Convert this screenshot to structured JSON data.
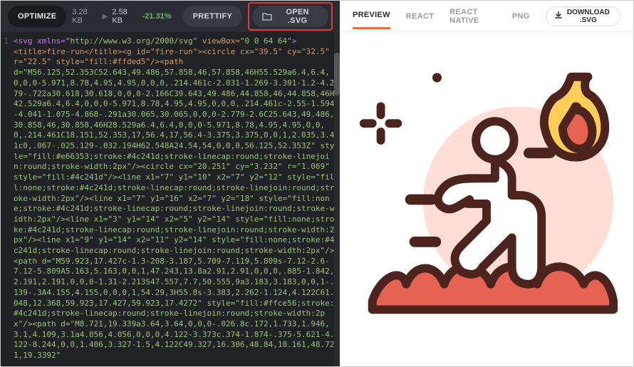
{
  "toolbar": {
    "optimize_label": "OPTIMIZE",
    "size_before": "3.28 KB",
    "size_after": "2.58 KB",
    "size_pct": "-21.31%",
    "prettify_label": "PRETTIFY",
    "open_label": "OPEN .SVG"
  },
  "tabs": {
    "preview": "PREVIEW",
    "react": "REACT",
    "react_native": "REACT NATIVE",
    "png": "PNG",
    "download": "DOWNLOAD .SVG"
  },
  "gutter": "1",
  "code": {
    "l00a": "<svg xmlns=",
    "l00b": "\"http://www.w3.org/2000/svg\"",
    "l00c": " viewBox=",
    "l00d": "\"0 0 64 64\"",
    "l00e": ">",
    "l01": "<title>fire-run</title><g id=\"fire-run\"><circle cx=\"39.5\" cy=\"32.5\" r=\"22.5\" style=\"fill:#ffded5\"/><path",
    "l02": "d=\"M56.125,52.353C52.643,49.486,57.858,46,57.858,46H55.529a6.4,6.4,0,0,0-5.971,8.78,4.95,4.95,0,0,0,.214.461c-2.031-1.269-3.391-1.2-4.279-.722a30.618,30.618,0,0,0-2.166C39.643,49.486,44.858,46,44.858,46H42.529a6.4,6.4,0,0,0-5.971,8.78,4.95,4.95,0,0,0,.214.461c-2.55-1.594-4.041-1.075-4.868-.291a30.065,30.065,0,0,0-2.779-2.6C25.643,49.486,30.858,46,30.858,46H28.529a6.4,6.4,0,0,0-5.971,8.78,4.95,4.95,0,0,0,.214.461C18.151,52.353,17,56.4,17,56.4-3.375,3.375,0,0,1,2.035,3.41c0,.067-.025.129-.032.194H62.548A24.54,54,0,0,0,56.125,52.353Z\" style=\"fill:#e66353;stroke:#4c241d;stroke-linecap:round;stroke-linejoin:round;stroke-width:2px\"/><circle cx=\"20.251\" cy=\"3.232\" r=\"1.069\" style=\"fill:#4c241d\"/><line x1=\"7\" y1=\"10\" x2=\"7\" y2=\"12\" style=\"fill:none;stroke:#4c241d;stroke-linecap:round;stroke-linejoin:round;stroke-width:2px\"/><line x1=\"7\" y1=\"16\" x2=\"7\" y2=\"18\" style=\"fill:none;stroke:#4c241d;stroke-linecap:round;stroke-linejoin:round;stroke-width:2px\"/><line x1=\"3\" y1=\"14\" x2=\"5\" y2=\"14\" style=\"fill:none;stroke:#4c241d;stroke-linecap:round;stroke-linejoin:round;stroke-width:2px\"/><line x1=\"9\" y1=\"14\" x2=\"11\" y2=\"14\" style=\"fill:none;stroke:#4c241d;stroke-linecap:round;stroke-linejoin:round;stroke-width:2px\"/><path d=\"M59.923,17.427c-1.3-208-3.187,5.709-7.119,5.809s-7.12-2.6-7.12-5.809A5.163,5.163,0,0,1,47.243,13.8a2.91,2.91,0,0,0,.885-1.842,2.191,2.191,0,0,0-1.31-2.213S47.557,7.7,50.555,9a3.183,3.183,0,0,1-.139-.3A4.155,4.155,0,0,0,1,54.29,3H55.8s-3.383,2.262-1.124,4.122C61.048,12.368,59.923,17.427,59.923,17.4272\" style=\"fill:#ffce56;stroke:#4c241d;stroke-linecap:round;stroke-linejoin:round;stroke-width:2px\"/><path d=\"M8.721,19.339a3.64,3.64,0,0,0-.026.8c.172,1.733,1.946,3.1,4.109,3.1a4.056,4.056,0,0,0,4.122-3.373c.374-1.874-.375-5.621-4.122-8.244,0,0,1.406,3.327-1.5,4.122C49.327,16.306,48.84,18.161,48.721,19.3392\"",
    "l_end": ""
  }
}
